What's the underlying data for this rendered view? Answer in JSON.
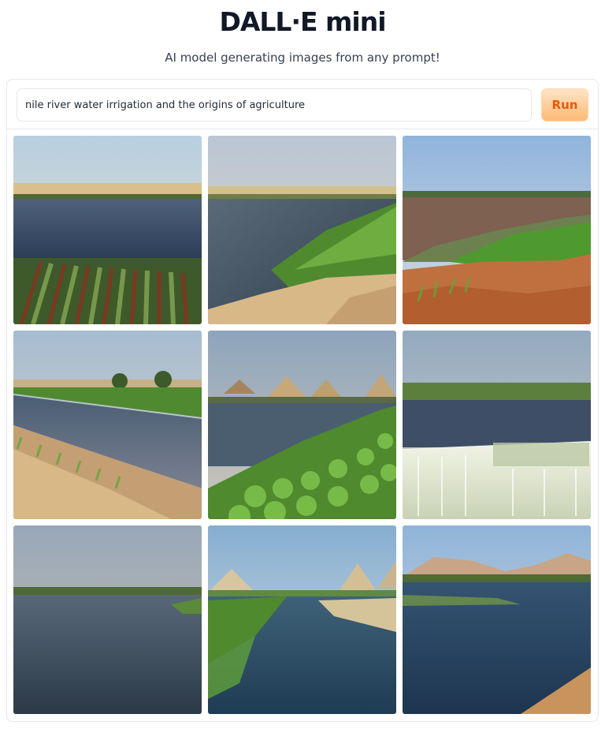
{
  "header": {
    "title": "DALL·E mini",
    "subtitle": "AI model generating images from any prompt!"
  },
  "prompt": {
    "value": "nile river water irrigation and the origins of agriculture"
  },
  "run_button": {
    "label": "Run"
  },
  "colors": {
    "accent": "#f97316",
    "run_button_text": "#ea580c",
    "run_button_bg": "#fdba74"
  }
}
